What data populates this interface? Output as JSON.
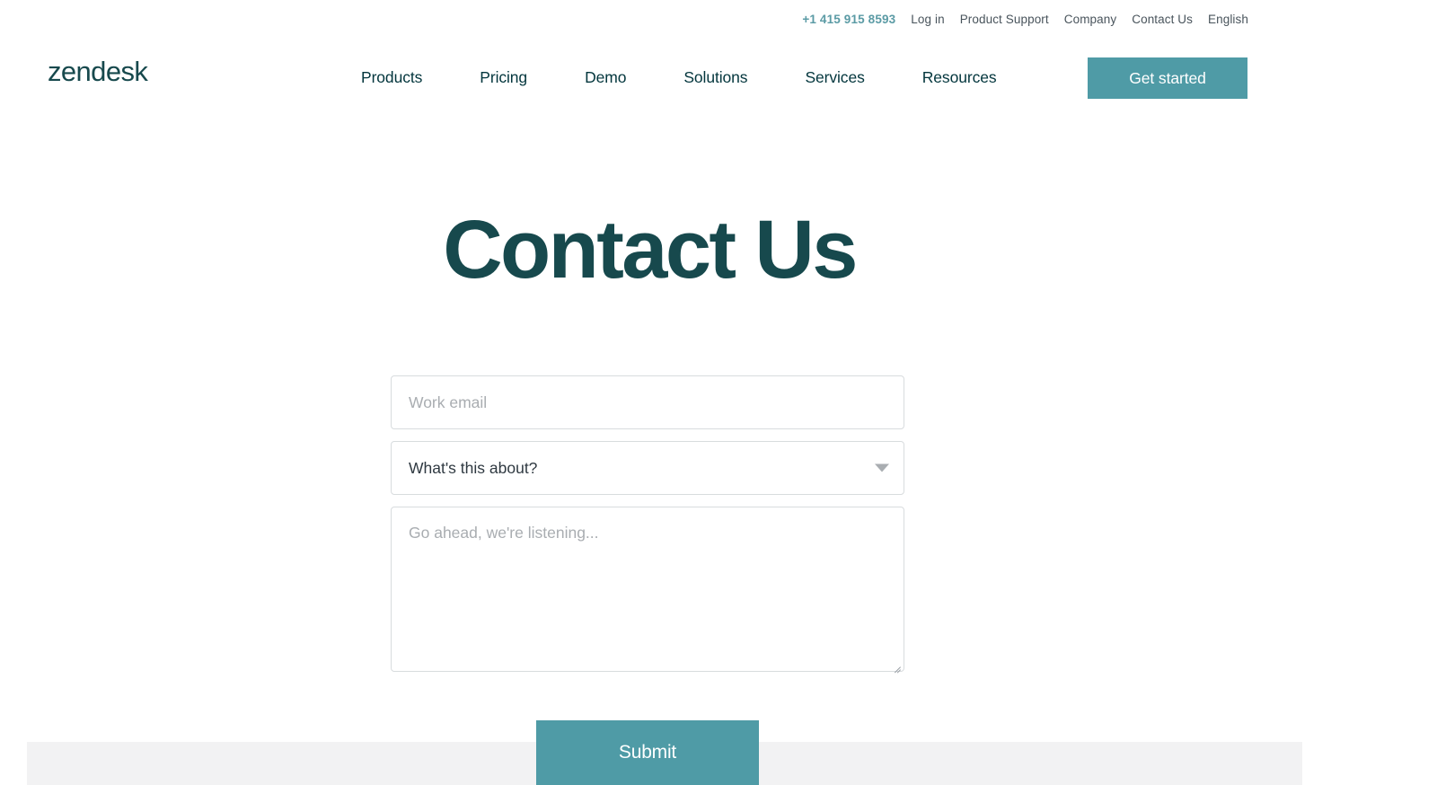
{
  "brand": {
    "logo_text": "zendesk",
    "accent_teal": "#4f9ba6",
    "dark_teal": "#17494d",
    "link_teal": "#5b9ba5"
  },
  "utility_bar": {
    "phone": "+1 415 915 8593",
    "items": [
      {
        "label": "Log in"
      },
      {
        "label": "Product Support"
      },
      {
        "label": "Company"
      },
      {
        "label": "Contact Us"
      },
      {
        "label": "English"
      }
    ]
  },
  "main_nav": {
    "items": [
      {
        "label": "Products"
      },
      {
        "label": "Pricing"
      },
      {
        "label": "Demo"
      },
      {
        "label": "Solutions"
      },
      {
        "label": "Services"
      },
      {
        "label": "Resources"
      }
    ],
    "cta_label": "Get started"
  },
  "hero": {
    "title": "Contact Us"
  },
  "form": {
    "email": {
      "value": "",
      "placeholder": "Work email"
    },
    "topic": {
      "selected_label": "What's this about?",
      "caret_icon": "chevron-down-icon"
    },
    "message": {
      "value": "",
      "placeholder": "Go ahead, we're listening..."
    },
    "submit_label": "Submit"
  }
}
